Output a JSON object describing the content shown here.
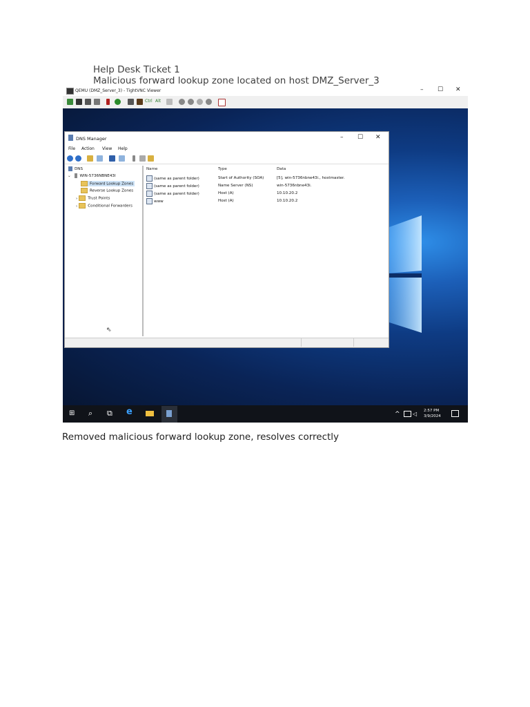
{
  "document": {
    "heading": "Help Desk Ticket 1",
    "subheading": "Malicious forward lookup zone located on host DMZ_Server_3",
    "caption": "Removed malicious forward lookup zone, resolves correctly"
  },
  "vnc_window": {
    "title": "QEMU (DMZ_Server_3) - TightVNC Viewer",
    "toolbar_text": [
      "Ctrl",
      "Alt"
    ],
    "controls": [
      "–",
      "☐",
      "✕"
    ]
  },
  "dns_manager": {
    "title": "DNS Manager",
    "menu": [
      "File",
      "Action",
      "View",
      "Help"
    ],
    "controls": [
      "–",
      "☐",
      "✕"
    ],
    "tree": {
      "root": "DNS",
      "server": "WIN-5736NBNE43I",
      "items": [
        "Forward Lookup Zones",
        "Reverse Lookup Zones",
        "Trust Points",
        "Conditional Forwarders"
      ],
      "selected": "Forward Lookup Zones"
    },
    "list": {
      "columns": [
        "Name",
        "Type",
        "Data"
      ],
      "rows": [
        [
          "(same as parent folder)",
          "Start of Authority (SOA)",
          "[5], win-5736nbne43i., hostmaster."
        ],
        [
          "(same as parent folder)",
          "Name Server (NS)",
          "win-5736nbne43i."
        ],
        [
          "(same as parent folder)",
          "Host (A)",
          "10.10.20.2"
        ],
        [
          "www",
          "Host (A)",
          "10.10.20.2"
        ]
      ]
    }
  },
  "taskbar": {
    "time": "2:57 PM",
    "date": "3/9/2024"
  }
}
